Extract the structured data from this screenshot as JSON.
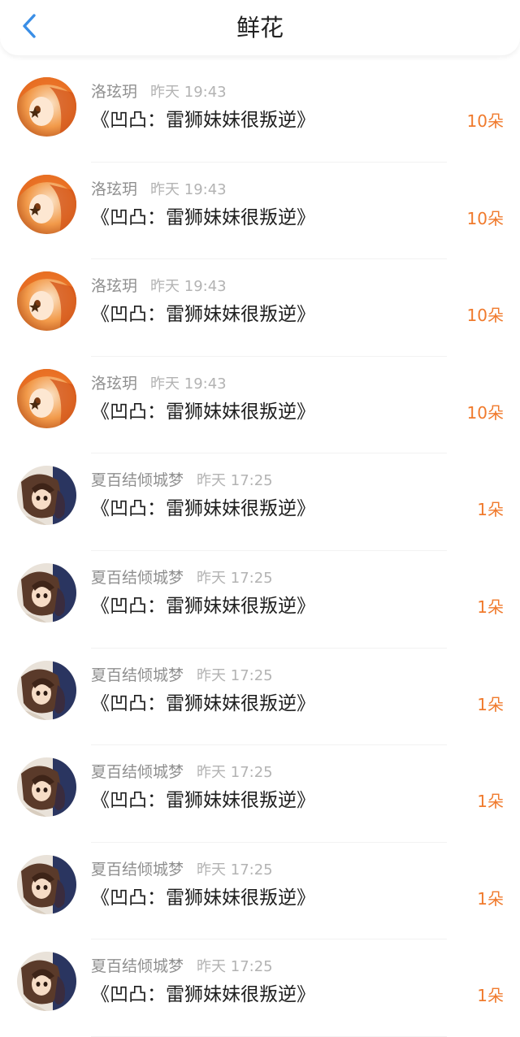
{
  "header": {
    "title": "鲜花",
    "back_icon": "chevron-left-icon"
  },
  "colors": {
    "accent_blue": "#3a8ee6",
    "count_orange": "#f07a2c"
  },
  "records": [
    {
      "user": "洛玹玥",
      "time": "昨天 19:43",
      "title": "《凹凸：雷狮妹妹很叛逆》",
      "count": "10朵",
      "avatar": "orange-hair-avatar"
    },
    {
      "user": "洛玹玥",
      "time": "昨天 19:43",
      "title": "《凹凸：雷狮妹妹很叛逆》",
      "count": "10朵",
      "avatar": "orange-hair-avatar"
    },
    {
      "user": "洛玹玥",
      "time": "昨天 19:43",
      "title": "《凹凸：雷狮妹妹很叛逆》",
      "count": "10朵",
      "avatar": "orange-hair-avatar"
    },
    {
      "user": "洛玹玥",
      "time": "昨天 19:43",
      "title": "《凹凸：雷狮妹妹很叛逆》",
      "count": "10朵",
      "avatar": "orange-hair-avatar"
    },
    {
      "user": "夏百结倾城梦",
      "time": "昨天 17:25",
      "title": "《凹凸：雷狮妹妹很叛逆》",
      "count": "1朵",
      "avatar": "dark-hair-avatar"
    },
    {
      "user": "夏百结倾城梦",
      "time": "昨天 17:25",
      "title": "《凹凸：雷狮妹妹很叛逆》",
      "count": "1朵",
      "avatar": "dark-hair-avatar"
    },
    {
      "user": "夏百结倾城梦",
      "time": "昨天 17:25",
      "title": "《凹凸：雷狮妹妹很叛逆》",
      "count": "1朵",
      "avatar": "dark-hair-avatar"
    },
    {
      "user": "夏百结倾城梦",
      "time": "昨天 17:25",
      "title": "《凹凸：雷狮妹妹很叛逆》",
      "count": "1朵",
      "avatar": "dark-hair-avatar"
    },
    {
      "user": "夏百结倾城梦",
      "time": "昨天 17:25",
      "title": "《凹凸：雷狮妹妹很叛逆》",
      "count": "1朵",
      "avatar": "dark-hair-avatar"
    },
    {
      "user": "夏百结倾城梦",
      "time": "昨天 17:25",
      "title": "《凹凸：雷狮妹妹很叛逆》",
      "count": "1朵",
      "avatar": "dark-hair-avatar"
    }
  ]
}
